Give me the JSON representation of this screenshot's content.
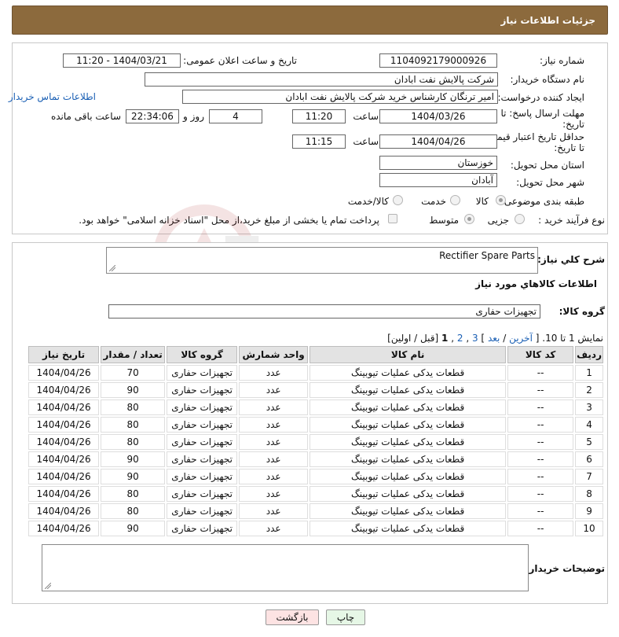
{
  "header": {
    "title": "جزئیات اطلاعات نیاز"
  },
  "form": {
    "need_number_label": "شماره نیاز:",
    "need_number": "1104092179000926",
    "announce_label": "تاریخ و ساعت اعلان عمومی:",
    "announce_value": "1404/03/21 - 11:20",
    "buyer_org_label": "نام دستگاه خریدار:",
    "buyer_org": "شرکت پالایش نفت ابادان",
    "creator_label": "ایجاد کننده درخواست:",
    "creator": "امیر ترنگان کارشناس خرید شرکت پالایش نفت ابادان",
    "contact_link": "اطلاعات تماس خریدار",
    "deadline_label_1": "مهلت ارسال پاسخ: تا",
    "deadline_label_2": "تاریخ:",
    "deadline_date": "1404/03/26",
    "time_label": "ساعت",
    "deadline_time": "11:20",
    "days_value": "4",
    "days_label": "روز و",
    "remaining_time": "22:34:06",
    "remaining_label": "ساعت باقی مانده",
    "price_label_1": "حداقل تاریخ اعتبار قیمت:",
    "price_label_2": "تا تاریخ:",
    "price_date": "1404/04/26",
    "price_time": "11:15",
    "province_label": "استان محل تحویل:",
    "province": "خوزستان",
    "city_label": "شهر محل تحویل:",
    "city": "آبادان",
    "category_label": "طبقه بندی موضوعی:",
    "category_options": [
      "کالا",
      "خدمت",
      "کالا/خدمت"
    ],
    "category_selected": "کالا",
    "process_label": "نوع فرآیند خرید :",
    "process_options": [
      "جزیی",
      "متوسط"
    ],
    "process_selected": "متوسط",
    "payment_note": "پرداخت تمام یا بخشی از مبلغ خرید،از محل \"اسناد خزانه اسلامی\" خواهد بود."
  },
  "details": {
    "summary_label": "شرح کلي نياز:",
    "summary_value": "Rectifier Spare Parts",
    "goods_info_title": "اطلاعات کالاهاي مورد نياز",
    "goods_group_label": "گروه کالا:",
    "goods_group_value": "تجهیزات حفاری",
    "pagination": {
      "show_text": "نمایش 1 تا 10. [",
      "last": "آخرین",
      "sep1": " / ",
      "next": "بعد",
      "pages_tail": "] 3",
      "p3": "3",
      "p2": "2",
      "p1": "1",
      "prev_first": "[قبل / اولین]"
    },
    "table": {
      "headers": [
        "ردیف",
        "کد کالا",
        "نام کالا",
        "واحد شمارش",
        "گروه کالا",
        "تعداد / مقدار",
        "تاریخ نیاز"
      ],
      "rows": [
        [
          "1",
          "--",
          "قطعات یدکی عملیات تیوبینگ",
          "عدد",
          "تجهیزات حفاری",
          "70",
          "1404/04/26"
        ],
        [
          "2",
          "--",
          "قطعات یدکی عملیات تیوبینگ",
          "عدد",
          "تجهیزات حفاری",
          "90",
          "1404/04/26"
        ],
        [
          "3",
          "--",
          "قطعات یدکی عملیات تیوبینگ",
          "عدد",
          "تجهیزات حفاری",
          "80",
          "1404/04/26"
        ],
        [
          "4",
          "--",
          "قطعات یدکی عملیات تیوبینگ",
          "عدد",
          "تجهیزات حفاری",
          "80",
          "1404/04/26"
        ],
        [
          "5",
          "--",
          "قطعات یدکی عملیات تیوبینگ",
          "عدد",
          "تجهیزات حفاری",
          "80",
          "1404/04/26"
        ],
        [
          "6",
          "--",
          "قطعات یدکی عملیات تیوبینگ",
          "عدد",
          "تجهیزات حفاری",
          "90",
          "1404/04/26"
        ],
        [
          "7",
          "--",
          "قطعات یدکی عملیات تیوبینگ",
          "عدد",
          "تجهیزات حفاری",
          "90",
          "1404/04/26"
        ],
        [
          "8",
          "--",
          "قطعات یدکی عملیات تیوبینگ",
          "عدد",
          "تجهیزات حفاری",
          "80",
          "1404/04/26"
        ],
        [
          "9",
          "--",
          "قطعات یدکی عملیات تیوبینگ",
          "عدد",
          "تجهیزات حفاری",
          "80",
          "1404/04/26"
        ],
        [
          "10",
          "--",
          "قطعات یدکی عملیات تیوبینگ",
          "عدد",
          "تجهیزات حفاری",
          "90",
          "1404/04/26"
        ]
      ]
    },
    "buyer_notes_label": "توضیحات خریدار:"
  },
  "buttons": {
    "print": "چاپ",
    "back": "بازگشت"
  },
  "watermark_text": "AriaTender.neT",
  "colors": {
    "header_bg": "#8c6a3d",
    "link": "#1a5fb4",
    "back_button_bg": "#fde3e3",
    "print_button_bg": "#e6f7e6"
  }
}
